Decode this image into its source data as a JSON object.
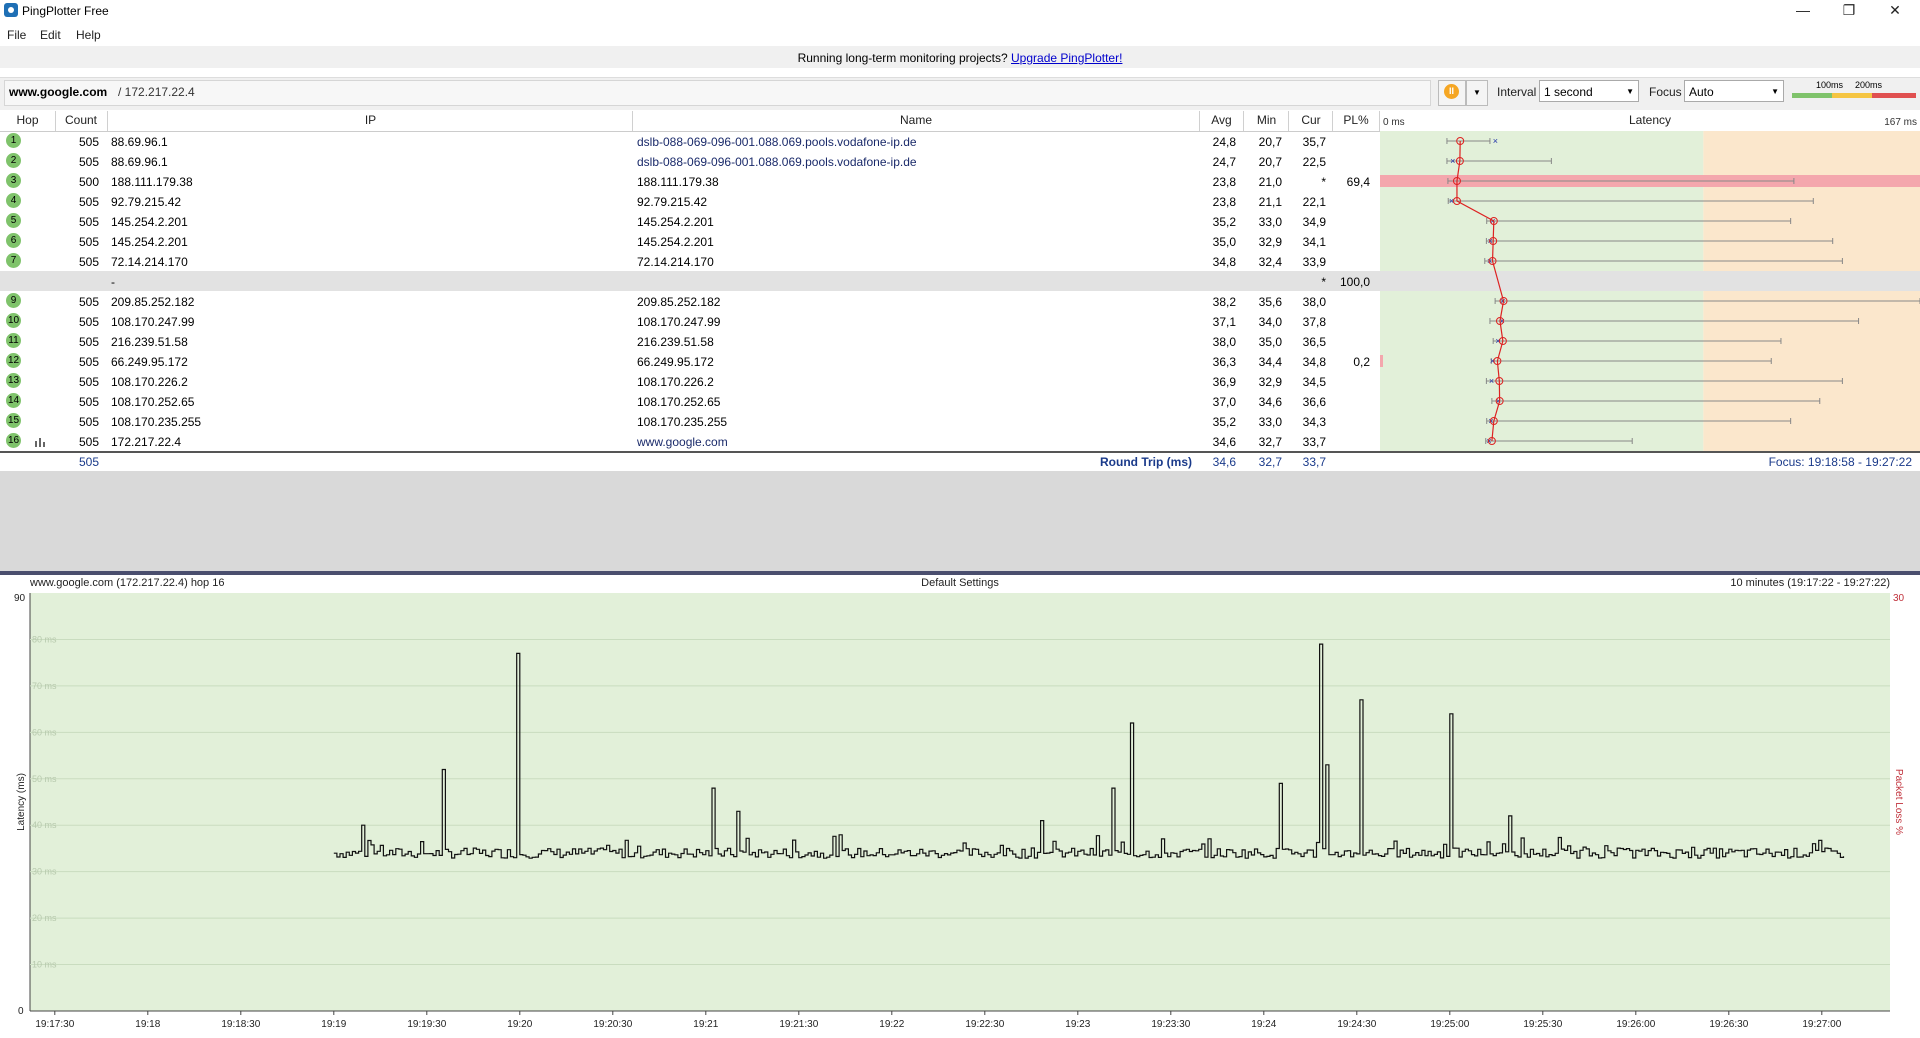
{
  "window": {
    "title": "PingPlotter Free",
    "controls": {
      "minimize": "—",
      "maximize": "❐",
      "close": "✕"
    }
  },
  "menu": [
    "File",
    "Edit",
    "Help"
  ],
  "promo": {
    "text": "Running long-term monitoring projects?",
    "link": "Upgrade PingPlotter!"
  },
  "toolbar": {
    "target_host": "www.google.com",
    "target_ip": "/ 172.217.22.4",
    "interval_label": "Interval",
    "interval_value": "1 second",
    "focus_label": "Focus",
    "focus_value": "Auto",
    "scale_labels": [
      "100ms",
      "200ms"
    ],
    "colors": {
      "pause": "#f5a623",
      "green": "#7fc36b",
      "yellow": "#f5c542",
      "red": "#e05050"
    }
  },
  "table": {
    "headers": {
      "hop": "Hop",
      "count": "Count",
      "ip": "IP",
      "name": "Name",
      "avg": "Avg",
      "min": "Min",
      "cur": "Cur",
      "pl": "PL%",
      "zero": "0 ms",
      "latency": "Latency",
      "max": "167 ms"
    },
    "rows": [
      {
        "hop": "1",
        "count": "505",
        "ip": "88.69.96.1",
        "name": "dslb-088-069-096-001.088.069.pools.vodafone-ip.de",
        "avg": "24,8",
        "min": "20,7",
        "cur": "35,7",
        "pl": "",
        "mean": 24.8,
        "minv": 20.7,
        "curv": 35.7,
        "maxv": 34
      },
      {
        "hop": "2",
        "count": "505",
        "ip": "88.69.96.1",
        "name": "dslb-088-069-096-001.088.069.pools.vodafone-ip.de",
        "avg": "24,7",
        "min": "20,7",
        "cur": "22,5",
        "pl": "",
        "mean": 24.7,
        "minv": 20.7,
        "curv": 22.5,
        "maxv": 53
      },
      {
        "hop": "3",
        "count": "500",
        "ip": "188.111.179.38",
        "name": "188.111.179.38",
        "avg": "23,8",
        "min": "21,0",
        "cur": "*",
        "pl": "69,4",
        "mean": 23.8,
        "minv": 21.0,
        "curv": null,
        "maxv": 128
      },
      {
        "hop": "4",
        "count": "505",
        "ip": "92.79.215.42",
        "name": "92.79.215.42",
        "avg": "23,8",
        "min": "21,1",
        "cur": "22,1",
        "pl": "",
        "mean": 23.8,
        "minv": 21.1,
        "curv": 22.1,
        "maxv": 134
      },
      {
        "hop": "5",
        "count": "505",
        "ip": "145.254.2.201",
        "name": "145.254.2.201",
        "avg": "35,2",
        "min": "33,0",
        "cur": "34,9",
        "pl": "",
        "mean": 35.2,
        "minv": 33.0,
        "curv": 34.9,
        "maxv": 127
      },
      {
        "hop": "6",
        "count": "505",
        "ip": "145.254.2.201",
        "name": "145.254.2.201",
        "avg": "35,0",
        "min": "32,9",
        "cur": "34,1",
        "pl": "",
        "mean": 35.0,
        "minv": 32.9,
        "curv": 34.1,
        "maxv": 140
      },
      {
        "hop": "7",
        "count": "505",
        "ip": "72.14.214.170",
        "name": "72.14.214.170",
        "avg": "34,8",
        "min": "32,4",
        "cur": "33,9",
        "pl": "",
        "mean": 34.8,
        "minv": 32.4,
        "curv": 33.9,
        "maxv": 143
      },
      {
        "hop": "",
        "count": "",
        "ip": "-",
        "name": "",
        "avg": "",
        "min": "",
        "cur": "*",
        "pl": "100,0",
        "gray": true
      },
      {
        "hop": "9",
        "count": "505",
        "ip": "209.85.252.182",
        "name": "209.85.252.182",
        "avg": "38,2",
        "min": "35,6",
        "cur": "38,0",
        "pl": "",
        "mean": 38.2,
        "minv": 35.6,
        "curv": 38.0,
        "maxv": 167
      },
      {
        "hop": "10",
        "count": "505",
        "ip": "108.170.247.99",
        "name": "108.170.247.99",
        "avg": "37,1",
        "min": "34,0",
        "cur": "37,8",
        "pl": "",
        "mean": 37.1,
        "minv": 34.0,
        "curv": 37.8,
        "maxv": 148
      },
      {
        "hop": "11",
        "count": "505",
        "ip": "216.239.51.58",
        "name": "216.239.51.58",
        "avg": "38,0",
        "min": "35,0",
        "cur": "36,5",
        "pl": "",
        "mean": 38.0,
        "minv": 35.0,
        "curv": 36.5,
        "maxv": 124
      },
      {
        "hop": "12",
        "count": "505",
        "ip": "66.249.95.172",
        "name": "66.249.95.172",
        "avg": "36,3",
        "min": "34,4",
        "cur": "34,8",
        "pl": "0,2",
        "mean": 36.3,
        "minv": 34.4,
        "curv": 34.8,
        "maxv": 121
      },
      {
        "hop": "13",
        "count": "505",
        "ip": "108.170.226.2",
        "name": "108.170.226.2",
        "avg": "36,9",
        "min": "32,9",
        "cur": "34,5",
        "pl": "",
        "mean": 36.9,
        "minv": 32.9,
        "curv": 34.5,
        "maxv": 143
      },
      {
        "hop": "14",
        "count": "505",
        "ip": "108.170.252.65",
        "name": "108.170.252.65",
        "avg": "37,0",
        "min": "34,6",
        "cur": "36,6",
        "pl": "",
        "mean": 37.0,
        "minv": 34.6,
        "curv": 36.6,
        "maxv": 136
      },
      {
        "hop": "15",
        "count": "505",
        "ip": "108.170.235.255",
        "name": "108.170.235.255",
        "avg": "35,2",
        "min": "33,0",
        "cur": "34,3",
        "pl": "",
        "mean": 35.2,
        "minv": 33.0,
        "curv": 34.3,
        "maxv": 127
      },
      {
        "hop": "16",
        "count": "505",
        "ip": "172.217.22.4",
        "name": "www.google.com",
        "avg": "34,6",
        "min": "32,7",
        "cur": "33,7",
        "pl": "",
        "mean": 34.6,
        "minv": 32.7,
        "curv": 33.7,
        "maxv": 78
      }
    ]
  },
  "summary": {
    "count": "505",
    "label": "Round Trip (ms)",
    "avg": "34,6",
    "min": "32,7",
    "cur": "33,7",
    "focus": "Focus: 19:18:58 - 19:27:22"
  },
  "graph": {
    "target": "www.google.com (172.217.22.4) hop 16",
    "settings": "Default Settings",
    "range": "10 minutes (19:17:22 - 19:27:22)",
    "y_left_max": "90",
    "y_left_min": "0",
    "y_right_max": "30",
    "y_label": "Latency (ms)",
    "y2_label": "Packet Loss %",
    "gridlines": [
      "80 ms",
      "70 ms",
      "60 ms",
      "50 ms",
      "40 ms",
      "30 ms",
      "20 ms",
      "10 ms"
    ],
    "x_ticks": [
      "19:17:30",
      "19:18",
      "19:18:30",
      "19:19",
      "19:19:30",
      "19:20",
      "19:20:30",
      "19:21",
      "19:21:30",
      "19:22",
      "19:22:30",
      "19:23",
      "19:23:30",
      "19:24",
      "19:24:30",
      "19:25:00",
      "19:25:30",
      "19:26:00",
      "19:26:30",
      "19:27:00"
    ]
  },
  "chart_data": {
    "type": "line",
    "ylabel": "Latency (ms)",
    "ylim": [
      0,
      90
    ],
    "xlim": [
      "19:17:22",
      "19:27:22"
    ],
    "baseline_ms": 34,
    "data_start": "19:19:00",
    "spikes": [
      {
        "t": "19:19:09",
        "ms": 40
      },
      {
        "t": "19:19:35",
        "ms": 52
      },
      {
        "t": "19:19:59",
        "ms": 77
      },
      {
        "t": "19:21:02",
        "ms": 48
      },
      {
        "t": "19:21:10",
        "ms": 43
      },
      {
        "t": "19:23:17",
        "ms": 62
      },
      {
        "t": "19:23:11",
        "ms": 48
      },
      {
        "t": "19:22:48",
        "ms": 41
      },
      {
        "t": "19:24:05",
        "ms": 49
      },
      {
        "t": "19:24:18",
        "ms": 79
      },
      {
        "t": "19:24:20",
        "ms": 53
      },
      {
        "t": "19:24:31",
        "ms": 67
      },
      {
        "t": "19:25:00",
        "ms": 64
      },
      {
        "t": "19:25:19",
        "ms": 42
      },
      {
        "t": "19:27:10",
        "ms": 41
      }
    ]
  }
}
